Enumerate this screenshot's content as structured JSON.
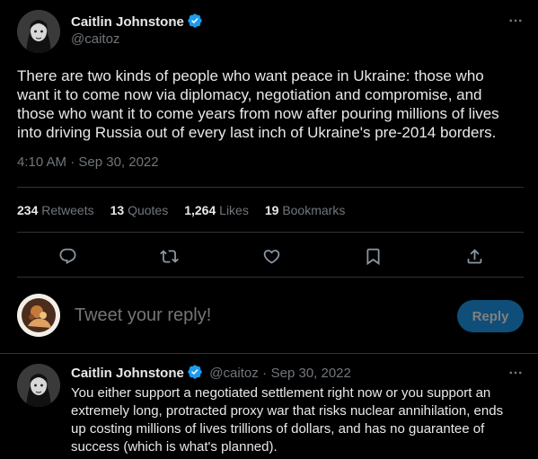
{
  "colors": {
    "background": "#000000",
    "text": "#e7e9ea",
    "secondary": "#71767b",
    "verified": "#1d9bf0",
    "reply_button_bg": "#0f4e78",
    "divider": "#2f3336"
  },
  "main_tweet": {
    "author_name": "Caitlin Johnstone",
    "author_handle": "@caitoz",
    "verified": true,
    "text_lines": [
      "There are two kinds of people who want peace in Ukraine: those who",
      "want it to come now via diplomacy, negotiation and compromise, and",
      "those who want it to come years from now after pouring millions of lives",
      "into driving Russia out of every last inch of Ukraine's pre-2014 borders."
    ],
    "timestamp": "4:10 AM · Sep 30, 2022",
    "stats": {
      "retweets_count": "234",
      "retweets_label": "Retweets",
      "quotes_count": "13",
      "quotes_label": "Quotes",
      "likes_count": "1,264",
      "likes_label": "Likes",
      "bookmarks_count": "19",
      "bookmarks_label": "Bookmarks"
    },
    "actions": [
      "reply-icon",
      "retweet-icon",
      "like-icon",
      "bookmark-icon",
      "share-icon"
    ]
  },
  "reply_box": {
    "placeholder": "Tweet your reply!",
    "button_label": "Reply"
  },
  "reply_tweet": {
    "author_name": "Caitlin Johnstone",
    "author_handle": "@caitoz",
    "separator": "·",
    "date": "Sep 30, 2022",
    "verified": true,
    "text_lines": [
      "You either support a negotiated settlement right now or you support an",
      "extremely long, protracted proxy war that risks nuclear annihilation, ends",
      "up costing millions of lives trillions of dollars, and has no guarantee of",
      "success (which is what's planned)."
    ]
  }
}
